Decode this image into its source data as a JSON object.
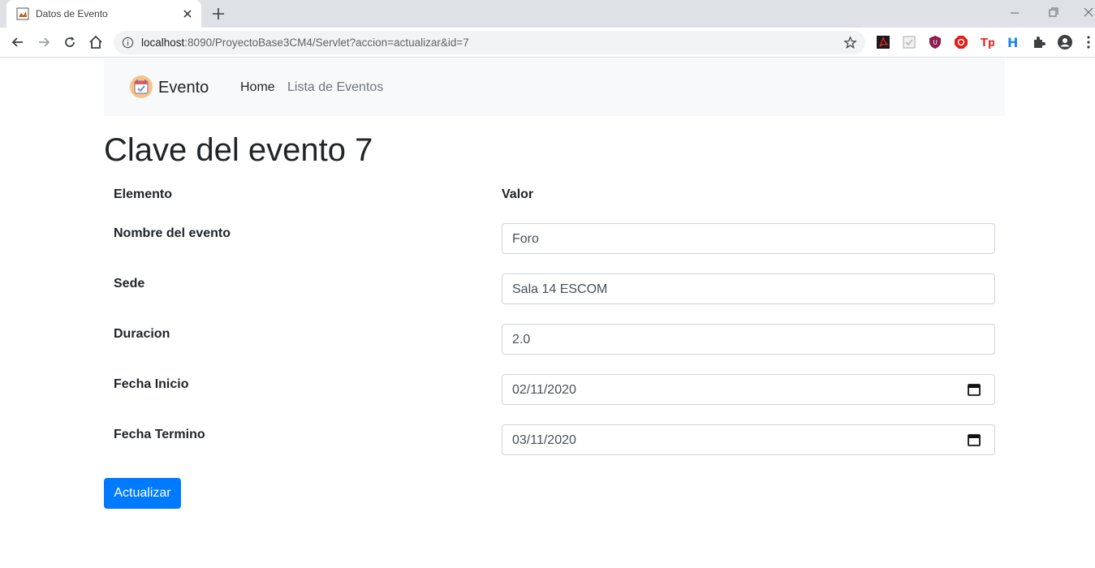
{
  "browser": {
    "tab_title": "Datos de Evento",
    "url_host": "localhost",
    "url_rest": ":8090/ProyectoBase3CM4/Servlet?accion=actualizar&id=7"
  },
  "navbar": {
    "brand": "Evento",
    "links": [
      "Home",
      "Lista de Eventos"
    ]
  },
  "page": {
    "title": "Clave del evento 7",
    "header_element": "Elemento",
    "header_value": "Valor",
    "fields": [
      {
        "label": "Nombre del evento",
        "value": "Foro"
      },
      {
        "label": "Sede",
        "value": "Sala 14 ESCOM"
      },
      {
        "label": "Duracion",
        "value": "2.0"
      },
      {
        "label": "Fecha Inicio",
        "value": "02/11/2020"
      },
      {
        "label": "Fecha Termino",
        "value": "03/11/2020"
      }
    ],
    "submit_label": "Actualizar"
  },
  "colors": {
    "primary": "#007bff",
    "navbar_bg": "#f8f9fa"
  }
}
